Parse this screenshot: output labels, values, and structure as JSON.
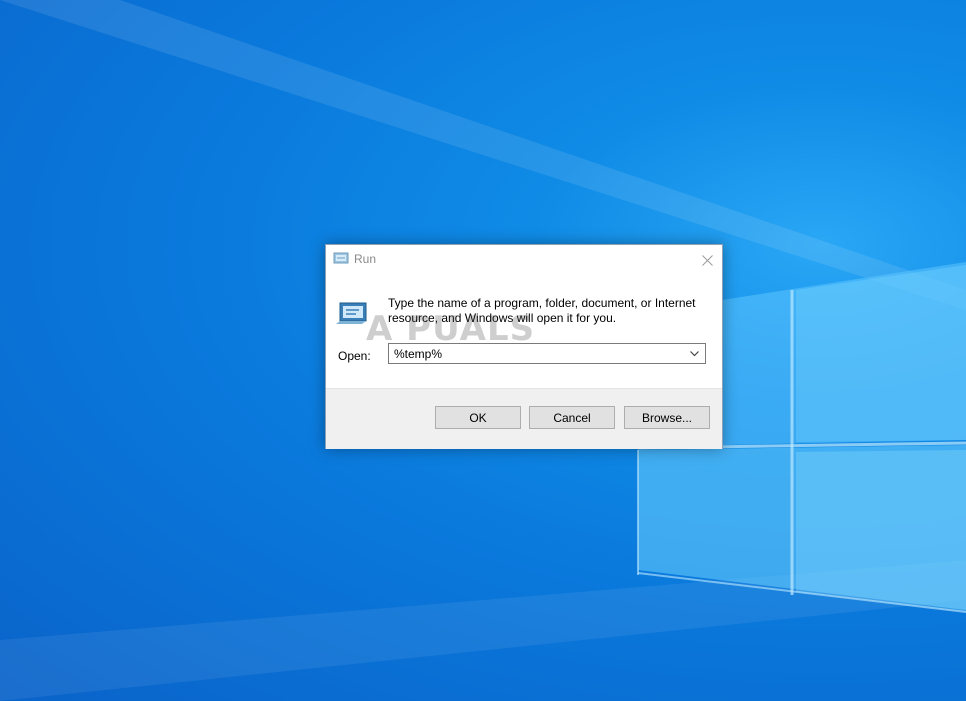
{
  "dialog": {
    "title": "Run",
    "prompt": "Type the name of a program, folder, document, or Internet resource, and Windows will open it for you.",
    "open_label": "Open:",
    "open_value": "%temp%",
    "buttons": {
      "ok": "OK",
      "cancel": "Cancel",
      "browse": "Browse..."
    }
  },
  "watermark": "A  PUALS",
  "icons": [
    "run-icon",
    "close-icon",
    "chevron-down-icon"
  ],
  "colors": {
    "desktop_blue": "#0a79dc",
    "button_face": "#e1e1e1",
    "dialog_bg": "#ffffff",
    "footer_bg": "#f0f0f0"
  }
}
